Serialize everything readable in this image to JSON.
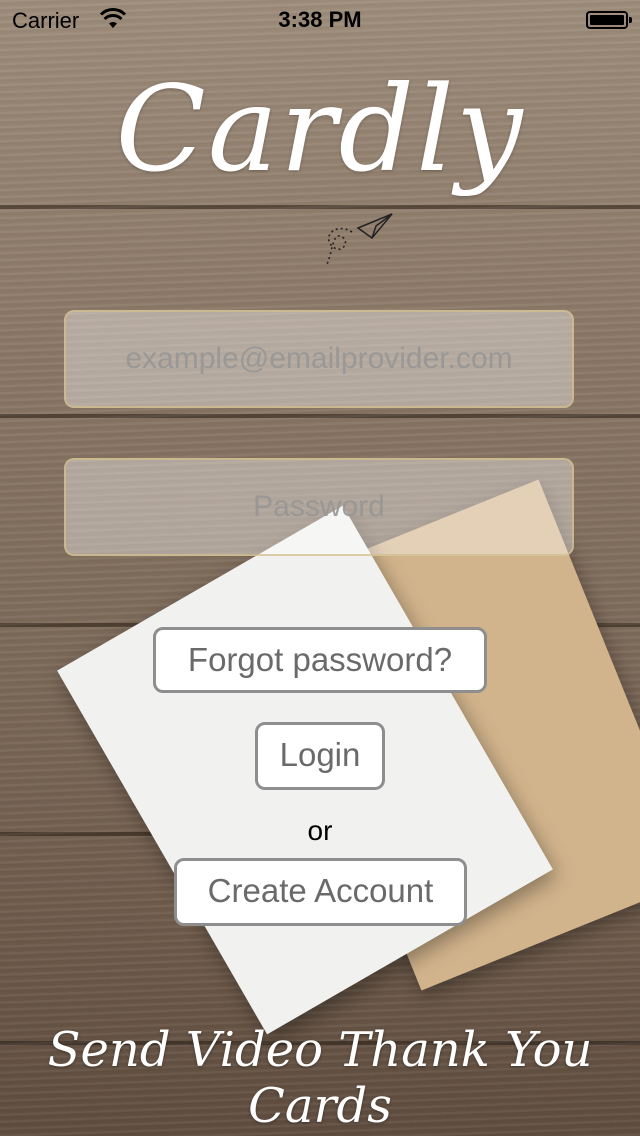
{
  "status_bar": {
    "carrier": "Carrier",
    "time": "3:38 PM"
  },
  "app": {
    "logo_text": "Cardly",
    "tagline": "Send Video Thank You Cards"
  },
  "form": {
    "email_placeholder": "example@emailprovider.com",
    "password_placeholder": "Password"
  },
  "actions": {
    "forgot_password_label": "Forgot password?",
    "login_label": "Login",
    "or_text": "or",
    "create_account_label": "Create Account"
  }
}
